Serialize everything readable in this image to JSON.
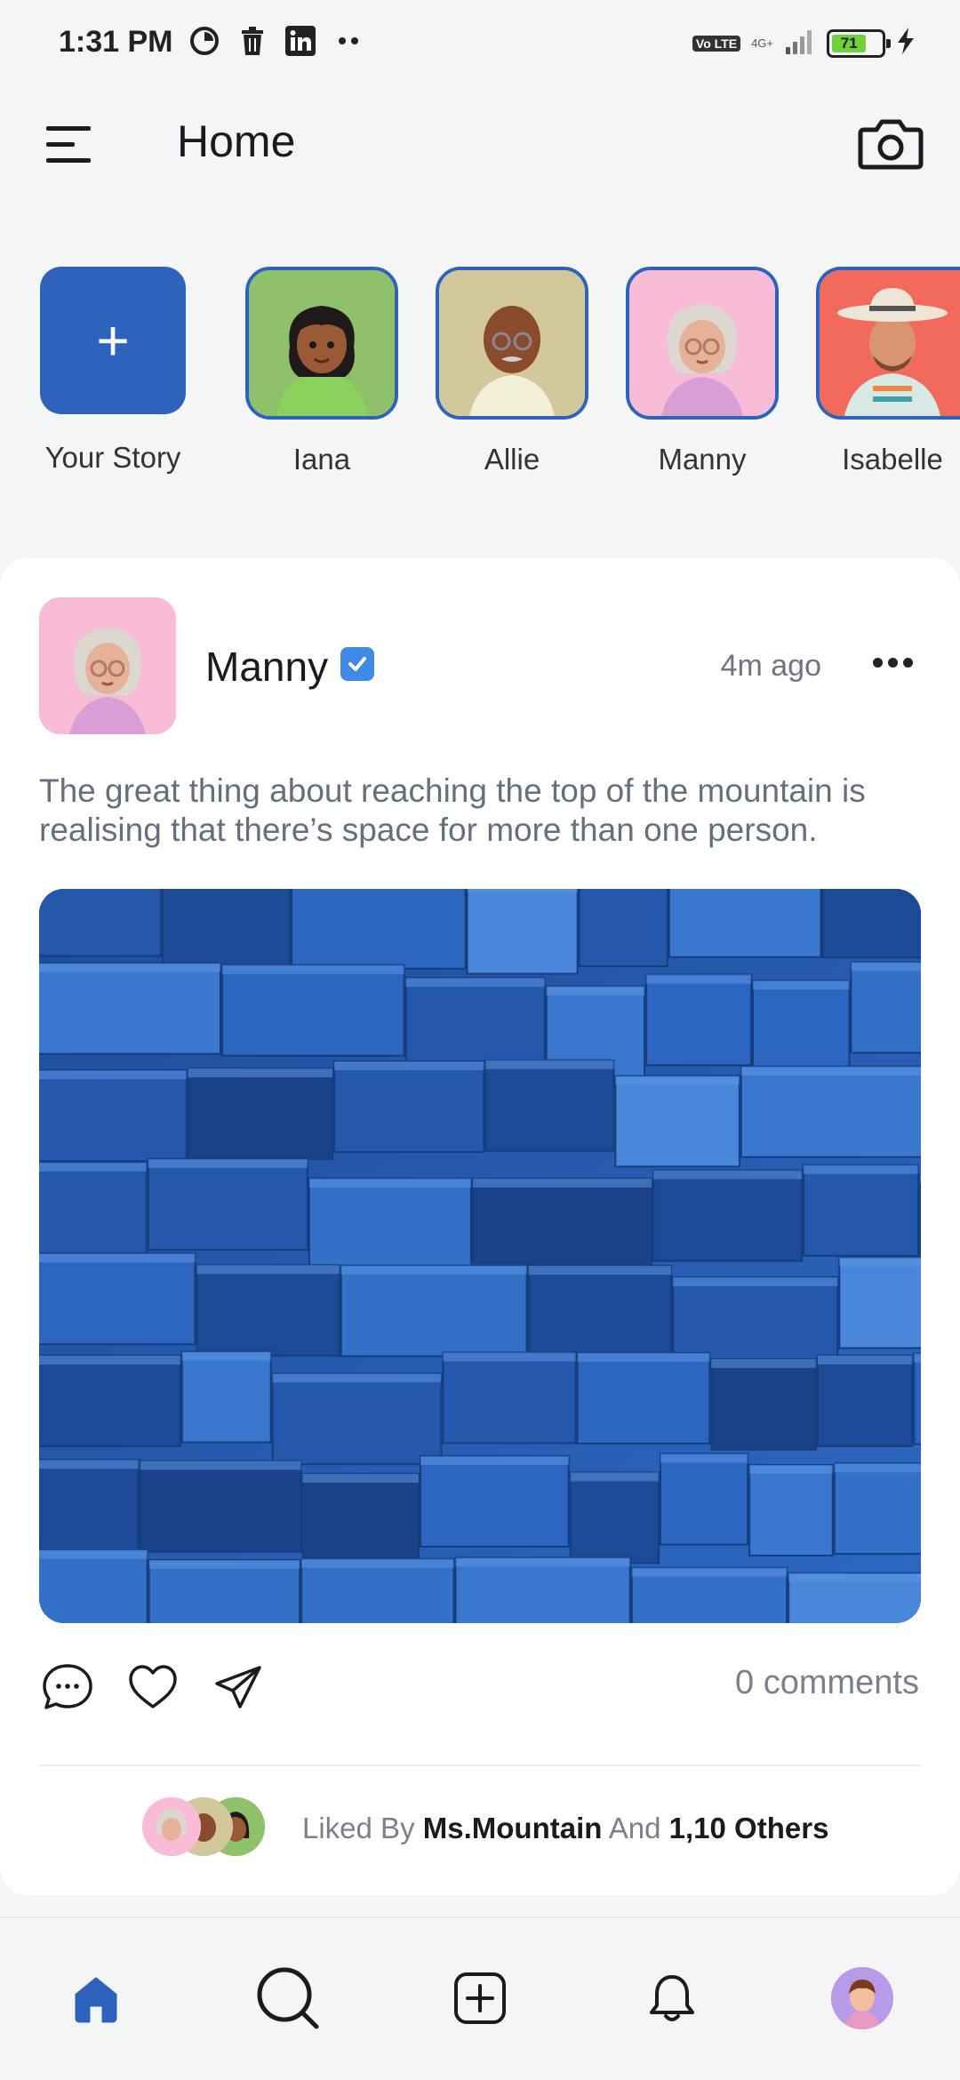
{
  "status_bar": {
    "time": "1:31 PM",
    "network": "4G+",
    "volte": "Vo LTE",
    "battery": "71",
    "battery_level": 0.71,
    "icons": [
      "sync-icon",
      "trash-icon",
      "linkedin-icon",
      "more-dots-icon",
      "signal-icon",
      "charging-icon"
    ]
  },
  "header": {
    "title": "Home",
    "menu_icon": "menu-icon",
    "camera_icon": "camera-icon"
  },
  "stories": {
    "add_label": "Your Story",
    "items": [
      {
        "name": "Iana",
        "bg": "#8fc06a"
      },
      {
        "name": "Allie",
        "bg": "#d2c89c"
      },
      {
        "name": "Manny",
        "bg": "#f8bcd6"
      },
      {
        "name": "Isabelle",
        "bg": "#f26a5c"
      }
    ]
  },
  "post": {
    "author": "Manny",
    "time_ago": "4m ago",
    "text": "The great thing about reaching the top of the mountain is realising that there’s space for more than one person.",
    "comments": "0 comments",
    "likes": {
      "prefix": "Liked By",
      "user": "Ms.Mountain",
      "middle": "And",
      "others": "1,10 Others"
    }
  },
  "bottom_nav": {
    "items": [
      "home-icon",
      "search-icon",
      "add-post-icon",
      "notifications-icon",
      "profile-avatar"
    ]
  },
  "colors": {
    "accent": "#2d63bd",
    "verified": "#3f8ae6",
    "muted_text": "#66707c"
  }
}
